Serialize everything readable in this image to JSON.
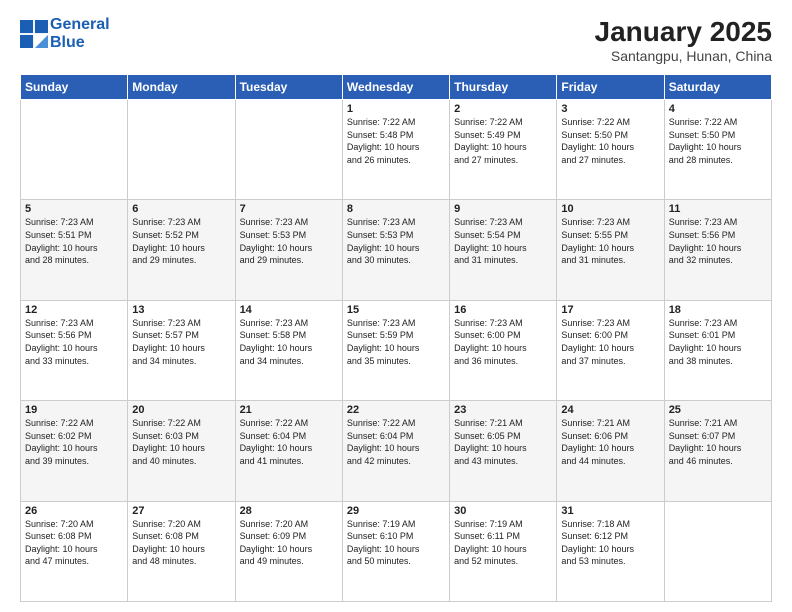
{
  "header": {
    "logo_line1": "General",
    "logo_line2": "Blue",
    "title": "January 2025",
    "subtitle": "Santangpu, Hunan, China"
  },
  "days_of_week": [
    "Sunday",
    "Monday",
    "Tuesday",
    "Wednesday",
    "Thursday",
    "Friday",
    "Saturday"
  ],
  "weeks": [
    [
      {
        "day": "",
        "detail": ""
      },
      {
        "day": "",
        "detail": ""
      },
      {
        "day": "",
        "detail": ""
      },
      {
        "day": "1",
        "detail": "Sunrise: 7:22 AM\nSunset: 5:48 PM\nDaylight: 10 hours\nand 26 minutes."
      },
      {
        "day": "2",
        "detail": "Sunrise: 7:22 AM\nSunset: 5:49 PM\nDaylight: 10 hours\nand 27 minutes."
      },
      {
        "day": "3",
        "detail": "Sunrise: 7:22 AM\nSunset: 5:50 PM\nDaylight: 10 hours\nand 27 minutes."
      },
      {
        "day": "4",
        "detail": "Sunrise: 7:22 AM\nSunset: 5:50 PM\nDaylight: 10 hours\nand 28 minutes."
      }
    ],
    [
      {
        "day": "5",
        "detail": "Sunrise: 7:23 AM\nSunset: 5:51 PM\nDaylight: 10 hours\nand 28 minutes."
      },
      {
        "day": "6",
        "detail": "Sunrise: 7:23 AM\nSunset: 5:52 PM\nDaylight: 10 hours\nand 29 minutes."
      },
      {
        "day": "7",
        "detail": "Sunrise: 7:23 AM\nSunset: 5:53 PM\nDaylight: 10 hours\nand 29 minutes."
      },
      {
        "day": "8",
        "detail": "Sunrise: 7:23 AM\nSunset: 5:53 PM\nDaylight: 10 hours\nand 30 minutes."
      },
      {
        "day": "9",
        "detail": "Sunrise: 7:23 AM\nSunset: 5:54 PM\nDaylight: 10 hours\nand 31 minutes."
      },
      {
        "day": "10",
        "detail": "Sunrise: 7:23 AM\nSunset: 5:55 PM\nDaylight: 10 hours\nand 31 minutes."
      },
      {
        "day": "11",
        "detail": "Sunrise: 7:23 AM\nSunset: 5:56 PM\nDaylight: 10 hours\nand 32 minutes."
      }
    ],
    [
      {
        "day": "12",
        "detail": "Sunrise: 7:23 AM\nSunset: 5:56 PM\nDaylight: 10 hours\nand 33 minutes."
      },
      {
        "day": "13",
        "detail": "Sunrise: 7:23 AM\nSunset: 5:57 PM\nDaylight: 10 hours\nand 34 minutes."
      },
      {
        "day": "14",
        "detail": "Sunrise: 7:23 AM\nSunset: 5:58 PM\nDaylight: 10 hours\nand 34 minutes."
      },
      {
        "day": "15",
        "detail": "Sunrise: 7:23 AM\nSunset: 5:59 PM\nDaylight: 10 hours\nand 35 minutes."
      },
      {
        "day": "16",
        "detail": "Sunrise: 7:23 AM\nSunset: 6:00 PM\nDaylight: 10 hours\nand 36 minutes."
      },
      {
        "day": "17",
        "detail": "Sunrise: 7:23 AM\nSunset: 6:00 PM\nDaylight: 10 hours\nand 37 minutes."
      },
      {
        "day": "18",
        "detail": "Sunrise: 7:23 AM\nSunset: 6:01 PM\nDaylight: 10 hours\nand 38 minutes."
      }
    ],
    [
      {
        "day": "19",
        "detail": "Sunrise: 7:22 AM\nSunset: 6:02 PM\nDaylight: 10 hours\nand 39 minutes."
      },
      {
        "day": "20",
        "detail": "Sunrise: 7:22 AM\nSunset: 6:03 PM\nDaylight: 10 hours\nand 40 minutes."
      },
      {
        "day": "21",
        "detail": "Sunrise: 7:22 AM\nSunset: 6:04 PM\nDaylight: 10 hours\nand 41 minutes."
      },
      {
        "day": "22",
        "detail": "Sunrise: 7:22 AM\nSunset: 6:04 PM\nDaylight: 10 hours\nand 42 minutes."
      },
      {
        "day": "23",
        "detail": "Sunrise: 7:21 AM\nSunset: 6:05 PM\nDaylight: 10 hours\nand 43 minutes."
      },
      {
        "day": "24",
        "detail": "Sunrise: 7:21 AM\nSunset: 6:06 PM\nDaylight: 10 hours\nand 44 minutes."
      },
      {
        "day": "25",
        "detail": "Sunrise: 7:21 AM\nSunset: 6:07 PM\nDaylight: 10 hours\nand 46 minutes."
      }
    ],
    [
      {
        "day": "26",
        "detail": "Sunrise: 7:20 AM\nSunset: 6:08 PM\nDaylight: 10 hours\nand 47 minutes."
      },
      {
        "day": "27",
        "detail": "Sunrise: 7:20 AM\nSunset: 6:08 PM\nDaylight: 10 hours\nand 48 minutes."
      },
      {
        "day": "28",
        "detail": "Sunrise: 7:20 AM\nSunset: 6:09 PM\nDaylight: 10 hours\nand 49 minutes."
      },
      {
        "day": "29",
        "detail": "Sunrise: 7:19 AM\nSunset: 6:10 PM\nDaylight: 10 hours\nand 50 minutes."
      },
      {
        "day": "30",
        "detail": "Sunrise: 7:19 AM\nSunset: 6:11 PM\nDaylight: 10 hours\nand 52 minutes."
      },
      {
        "day": "31",
        "detail": "Sunrise: 7:18 AM\nSunset: 6:12 PM\nDaylight: 10 hours\nand 53 minutes."
      },
      {
        "day": "",
        "detail": ""
      }
    ]
  ]
}
